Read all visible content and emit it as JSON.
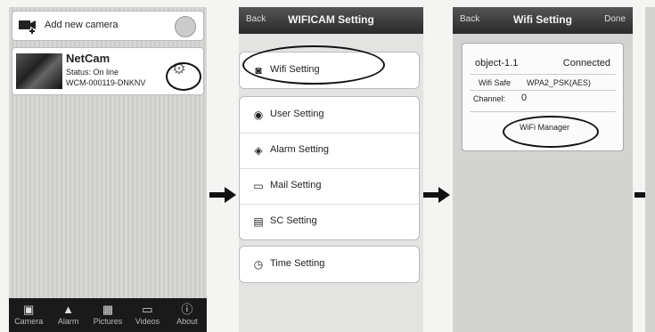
{
  "screen1": {
    "add_label": "Add new camera",
    "camera": {
      "name": "NetCam",
      "status": "Status: On line",
      "uid": "WCM-000119-DNKNV"
    },
    "tabs": [
      {
        "label": "Camera",
        "icon": "camera-icon"
      },
      {
        "label": "Alarm",
        "icon": "alarm-icon"
      },
      {
        "label": "Pictures",
        "icon": "pictures-icon"
      },
      {
        "label": "Videos",
        "icon": "videos-icon"
      },
      {
        "label": "About",
        "icon": "about-icon"
      }
    ]
  },
  "screen2": {
    "back": "Back",
    "title": "WIFICAM Setting",
    "items": [
      {
        "label": "Wifi Setting",
        "icon": "wifi-icon"
      },
      {
        "label": "User Setting",
        "icon": "user-icon"
      },
      {
        "label": "Alarm Setting",
        "icon": "alarm-icon"
      },
      {
        "label": "Mail Setting",
        "icon": "mail-icon"
      },
      {
        "label": "SC Setting",
        "icon": "sd-card-icon"
      },
      {
        "label": "Time Setting",
        "icon": "clock-icon"
      }
    ]
  },
  "screen3": {
    "back": "Back",
    "title": "Wifi Setting",
    "done": "Done",
    "ssid": "object-1.1",
    "state": "Connected",
    "safe_label": "Wifi Safe",
    "safe_value": "WPA2_PSK(AES)",
    "channel_label": "Channel:",
    "channel_value": "0",
    "manager": "WiFi Manager"
  }
}
